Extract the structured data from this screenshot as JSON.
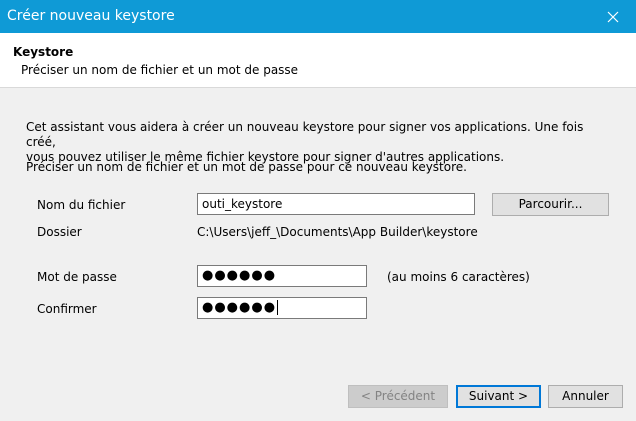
{
  "window": {
    "title": "Créer nouveau keystore",
    "close_icon": "close-icon"
  },
  "header": {
    "title": "Keystore",
    "subtitle": "Préciser un nom de fichier et un mot de passe"
  },
  "intro": {
    "line1": "Cet assistant vous aidera à créer un nouveau keystore pour signer vos applications. Une fois créé,",
    "line2": "vous pouvez utiliser le même fichier keystore pour signer d'autres applications.",
    "line3": "Préciser un nom de fichier et un mot de passe pour ce nouveau keystore."
  },
  "form": {
    "filename_label": "Nom du fichier",
    "filename_value": "outi_keystore",
    "browse_label": "Parcourir...",
    "folder_label": "Dossier",
    "folder_value": "C:\\Users\\jeff_\\Documents\\App Builder\\keystore",
    "password_label": "Mot de passe",
    "password_value": "●●●●●●",
    "password_hint": "(au moins 6 caractères)",
    "confirm_label": "Confirmer",
    "confirm_value": "●●●●●●"
  },
  "buttons": {
    "previous": "< Précédent",
    "next": "Suivant >",
    "cancel": "Annuler"
  }
}
